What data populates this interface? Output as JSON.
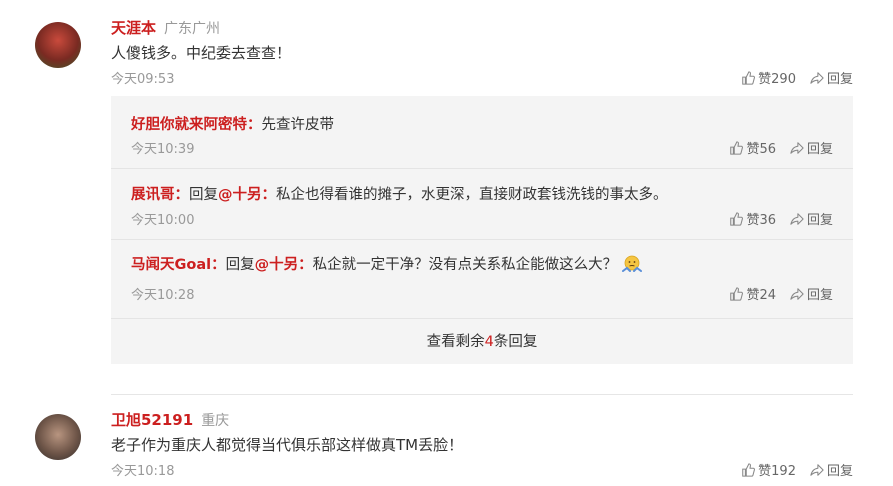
{
  "comments": [
    {
      "user": "天涯本",
      "location": "广东广州",
      "text": "人傻钱多。中纪委去查查！",
      "time": "今天09:53",
      "likes": "赞290",
      "reply_label": "回复"
    },
    {
      "user": "卫旭52191",
      "location": "重庆",
      "text": "老子作为重庆人都觉得当代俱乐部这样做真TM丢脸！",
      "time": "今天10:18",
      "likes": "赞192",
      "reply_label": "回复"
    }
  ],
  "replies": [
    {
      "user": "好胆你就来阿密特：",
      "reply_prefix": "",
      "mention": "",
      "text": "先查许皮带",
      "time": "今天10:39",
      "likes": "赞56",
      "reply_label": "回复"
    },
    {
      "user": "展讯哥：",
      "reply_prefix": "回复",
      "mention": "@十另：",
      "text": "私企也得看谁的摊子，水更深，直接财政套钱洗钱的事太多。",
      "time": "今天10:00",
      "likes": "赞36",
      "reply_label": "回复"
    },
    {
      "user": "马闻天Goal：",
      "reply_prefix": "回复",
      "mention": "@十另：",
      "text": "私企就一定干净？没有点关系私企能做这么大？",
      "time": "今天10:28",
      "likes": "赞24",
      "reply_label": "回复"
    }
  ],
  "more_replies": {
    "prefix": "查看剩余",
    "count": "4",
    "suffix": "条回复"
  },
  "colors": {
    "accent": "#cc1f1f",
    "meta": "#999999",
    "reply_bg": "#f4f4f4"
  },
  "icons": [
    "thumbs-up-icon",
    "reply-arrow-icon",
    "shrug-emoji-icon"
  ]
}
